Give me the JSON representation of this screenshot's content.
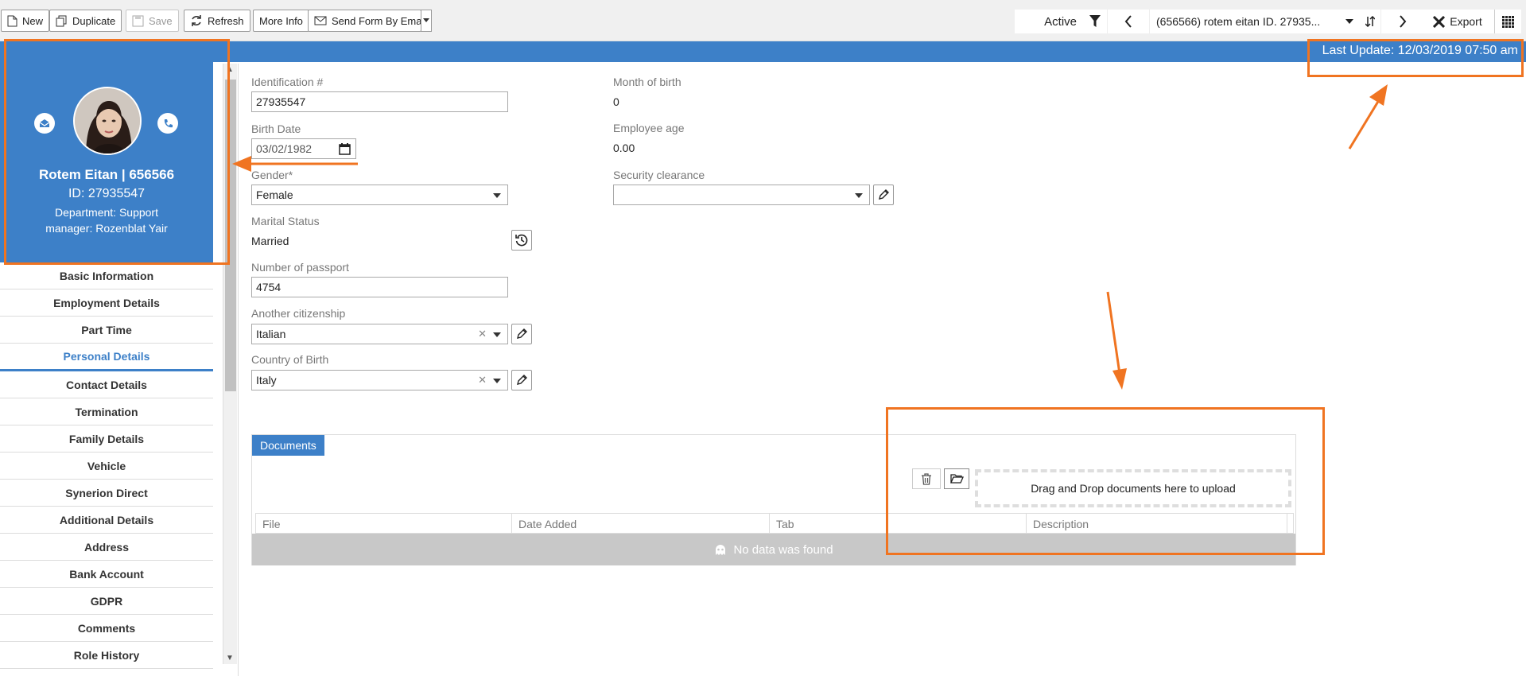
{
  "toolbar": {
    "new_label": "New",
    "duplicate_label": "Duplicate",
    "save_label": "Save",
    "refresh_label": "Refresh",
    "more_info_label": "More Info",
    "send_form_label": "Send Form By Email",
    "status": "Active",
    "record_title": "(656566) rotem eitan ID. 27935...",
    "export_label": "Export"
  },
  "header": {
    "last_update": "Last Update: 12/03/2019 07:50 am"
  },
  "profile": {
    "name": "Rotem Eitan | 656566",
    "id": "ID: 27935547",
    "department": "Department: Support",
    "manager": "manager: Rozenblat Yair"
  },
  "sidebar": {
    "items": [
      {
        "label": "Basic Information"
      },
      {
        "label": "Employment Details"
      },
      {
        "label": "Part Time"
      },
      {
        "label": "Personal Details"
      },
      {
        "label": "Contact Details"
      },
      {
        "label": "Termination"
      },
      {
        "label": "Family Details"
      },
      {
        "label": "Vehicle"
      },
      {
        "label": "Synerion Direct"
      },
      {
        "label": "Additional Details"
      },
      {
        "label": "Address"
      },
      {
        "label": "Bank Account"
      },
      {
        "label": "GDPR"
      },
      {
        "label": "Comments"
      },
      {
        "label": "Role History"
      }
    ],
    "active": "Personal Details"
  },
  "form": {
    "identification": {
      "label": "Identification #",
      "value": "27935547"
    },
    "birth_date": {
      "label": "Birth Date",
      "value": "03/02/1982"
    },
    "gender": {
      "label": "Gender*",
      "value": "Female"
    },
    "marital_status": {
      "label": "Marital Status",
      "value": "Married"
    },
    "passport": {
      "label": "Number of passport",
      "value": "4754"
    },
    "citizenship": {
      "label": "Another citizenship",
      "value": "Italian"
    },
    "country_of_birth": {
      "label": "Country of Birth",
      "value": "Italy"
    },
    "month_of_birth": {
      "label": "Month of birth",
      "value": "0"
    },
    "employee_age": {
      "label": "Employee age",
      "value": "0.00"
    },
    "security_clearance": {
      "label": "Security clearance",
      "value": ""
    }
  },
  "documents": {
    "tab_label": "Documents",
    "dropzone_text": "Drag and Drop documents here to upload",
    "columns": [
      "File",
      "Date Added",
      "Tab",
      "Description"
    ],
    "empty_text": "No data was found"
  },
  "colors": {
    "brand_blue": "#3d80c8",
    "annotation_orange": "#f07421"
  }
}
